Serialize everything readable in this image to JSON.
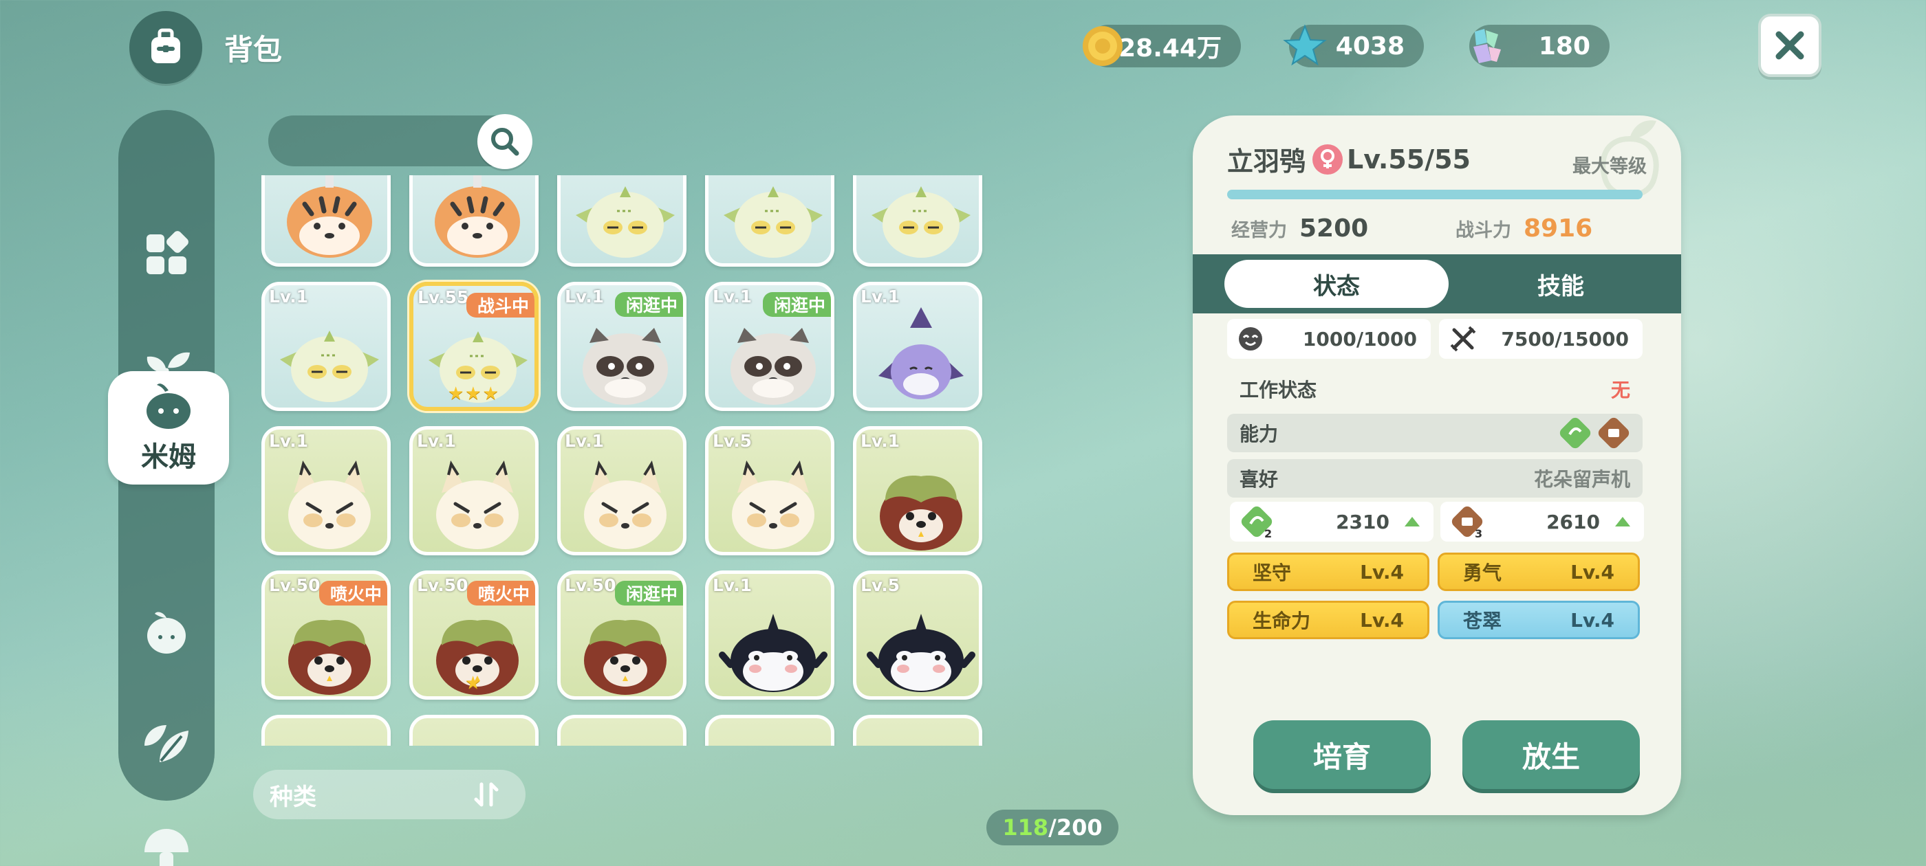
{
  "header": {
    "title": "背包"
  },
  "currencies": [
    {
      "icon": "gold-coin-icon",
      "value": "28.44万"
    },
    {
      "icon": "star-crystal-icon",
      "value": "4038"
    },
    {
      "icon": "gem-cluster-icon",
      "value": "180"
    }
  ],
  "sidebar": {
    "active_label": "米姆",
    "items": [
      "grid-icon",
      "sprout-icon",
      "mimu-icon",
      "fruit-icon",
      "leaf-icon",
      "mushroom-icon"
    ]
  },
  "grid": {
    "rows": [
      [
        {
          "level": "",
          "status": "",
          "status_color": "",
          "creature": "tiger",
          "bg": "blue"
        },
        {
          "level": "",
          "status": "",
          "status_color": "",
          "creature": "tiger",
          "bg": "blue"
        },
        {
          "level": "",
          "status": "",
          "status_color": "",
          "creature": "owl",
          "bg": "blue"
        },
        {
          "level": "",
          "status": "",
          "status_color": "",
          "creature": "owl",
          "bg": "blue"
        },
        {
          "level": "",
          "status": "",
          "status_color": "",
          "creature": "owl",
          "bg": "blue"
        }
      ],
      [
        {
          "level": "Lv.1",
          "status": "",
          "status_color": "",
          "creature": "owl",
          "bg": "blue"
        },
        {
          "level": "Lv.55",
          "status": "战斗中",
          "status_color": "orange",
          "creature": "owl",
          "bg": "blue",
          "selected": true,
          "stars": "★★★"
        },
        {
          "level": "Lv.1",
          "status": "闲逛中",
          "status_color": "green",
          "creature": "raccoon",
          "bg": "blue"
        },
        {
          "level": "Lv.1",
          "status": "闲逛中",
          "status_color": "green",
          "creature": "raccoon",
          "bg": "blue"
        },
        {
          "level": "Lv.1",
          "status": "",
          "status_color": "",
          "creature": "bat",
          "bg": "blue"
        }
      ],
      [
        {
          "level": "Lv.1",
          "status": "",
          "status_color": "",
          "creature": "fox",
          "bg": "green"
        },
        {
          "level": "Lv.1",
          "status": "",
          "status_color": "",
          "creature": "fox",
          "bg": "green"
        },
        {
          "level": "Lv.1",
          "status": "",
          "status_color": "",
          "creature": "fox",
          "bg": "green"
        },
        {
          "level": "Lv.5",
          "status": "",
          "status_color": "",
          "creature": "fox",
          "bg": "green"
        },
        {
          "level": "Lv.1",
          "status": "",
          "status_color": "",
          "creature": "bear",
          "bg": "green"
        }
      ],
      [
        {
          "level": "Lv.50",
          "status": "喷火中",
          "status_color": "orange",
          "creature": "bear",
          "bg": "green"
        },
        {
          "level": "Lv.50",
          "status": "喷火中",
          "status_color": "orange",
          "creature": "bear",
          "bg": "green",
          "stars": "★"
        },
        {
          "level": "Lv.50",
          "status": "闲逛中",
          "status_color": "green",
          "creature": "bear",
          "bg": "green"
        },
        {
          "level": "Lv.1",
          "status": "",
          "status_color": "",
          "creature": "orca",
          "bg": "green"
        },
        {
          "level": "Lv.5",
          "status": "",
          "status_color": "",
          "creature": "orca",
          "bg": "green"
        }
      ]
    ]
  },
  "sort": {
    "label": "种类",
    "icon": "sort-icon"
  },
  "capacity": {
    "current": "118",
    "max": "/200"
  },
  "detail": {
    "name": "立羽鸮",
    "gender_icon": "female-icon",
    "level": "Lv.55/55",
    "max_level_label": "最大等级",
    "xp_fill": 1.0,
    "manage_label": "经营力",
    "manage_value": "5200",
    "combat_label": "战斗力",
    "combat_value": "8916",
    "tabs": {
      "active": "状态",
      "other": "技能"
    },
    "mood": {
      "icon": "face-icon",
      "value": "1000/1000"
    },
    "food": {
      "icon": "utensils-icon",
      "value": "7500/15000"
    },
    "work_status_label": "工作状态",
    "work_status_value": "无",
    "ability_label": "能力",
    "hobby_label": "喜好",
    "hobby_value": "花朵留声机",
    "ability_a": {
      "icon": "green-ability-icon",
      "badge": "2",
      "value": "2310"
    },
    "ability_b": {
      "icon": "brown-ability-icon",
      "badge": "3",
      "value": "2610"
    },
    "traits": [
      {
        "name": "坚守",
        "level": "Lv.4",
        "color": "gold"
      },
      {
        "name": "勇气",
        "level": "Lv.4",
        "color": "gold"
      },
      {
        "name": "生命力",
        "level": "Lv.4",
        "color": "gold"
      },
      {
        "name": "苍翠",
        "level": "Lv.4",
        "color": "cyan"
      }
    ],
    "buttons": {
      "breed": "培育",
      "release": "放生"
    }
  },
  "colors": {
    "panel_header": "#3f6e66",
    "combat_value": "#ef9a4a",
    "status_orange": "#ef8a4f",
    "status_green": "#6fbf5f",
    "trait_gold": "#f6c336",
    "trait_cyan": "#86d0ea"
  }
}
